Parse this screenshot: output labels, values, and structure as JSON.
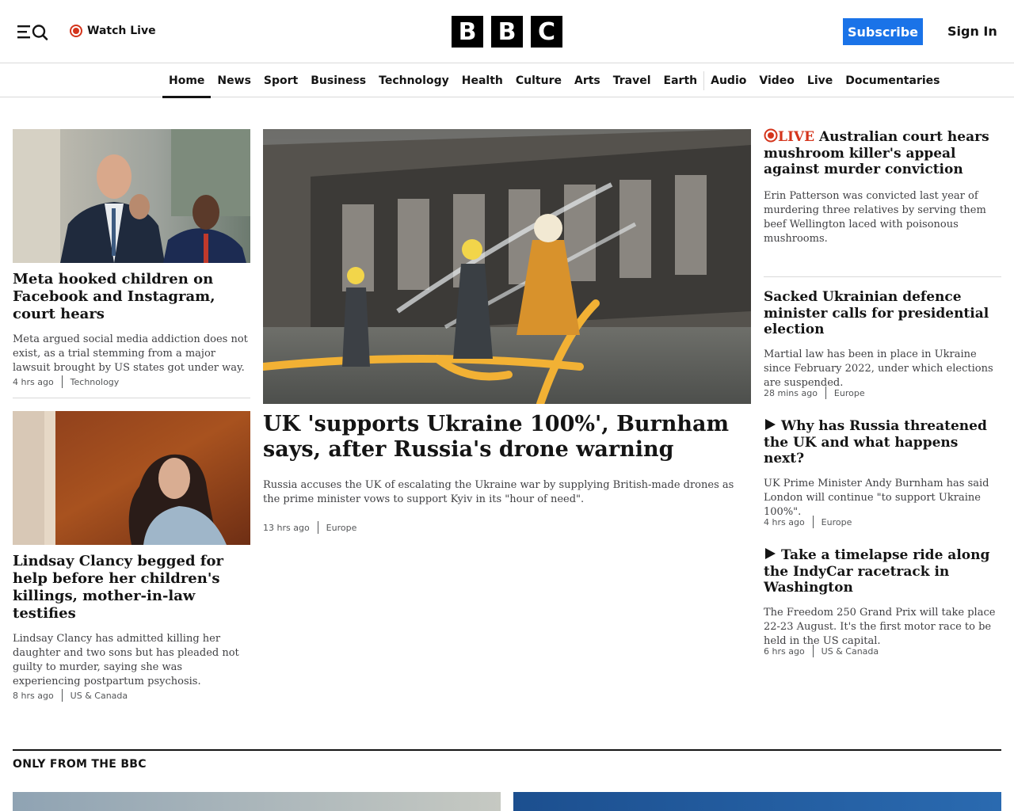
{
  "header": {
    "watch_live": "Watch Live",
    "logo_letters": [
      "B",
      "B",
      "C"
    ],
    "subscribe": "Subscribe",
    "sign_in": "Sign In",
    "accent_color": "#1a73e8",
    "live_color": "#d4351c"
  },
  "nav": {
    "items": [
      {
        "label": "Home",
        "active": true
      },
      {
        "label": "News"
      },
      {
        "label": "Sport"
      },
      {
        "label": "Business"
      },
      {
        "label": "Technology"
      },
      {
        "label": "Health"
      },
      {
        "label": "Culture"
      },
      {
        "label": "Arts"
      },
      {
        "label": "Travel"
      },
      {
        "label": "Earth"
      },
      {
        "label": "Audio"
      },
      {
        "label": "Video"
      },
      {
        "label": "Live"
      },
      {
        "label": "Documentaries"
      }
    ]
  },
  "left_stories": [
    {
      "headline": "Meta hooked children on Facebook and Instagram, court hears",
      "summary": "Meta argued social media addiction does not exist, as a trial stemming from a major lawsuit brought by US states got under way.",
      "time": "4 hrs ago",
      "section": "Technology"
    },
    {
      "headline": "Lindsay Clancy begged for help before her children's killings, mother-in-law testifies",
      "summary": "Lindsay Clancy has admitted killing her daughter and two sons but has pleaded not guilty to murder, saying she was experiencing postpartum psychosis.",
      "time": "8 hrs ago",
      "section": "US & Canada"
    }
  ],
  "main_story": {
    "headline": "UK 'supports Ukraine 100%', Burnham says, after Russia's drone warning",
    "summary": "Russia accuses the UK of escalating the Ukraine war by supplying British-made drones as the prime minister vows to support Kyiv in its \"hour of need\".",
    "time": "13 hrs ago",
    "section": "Europe"
  },
  "right_stories": [
    {
      "live_label": "LIVE",
      "headline": "Australian court hears mushroom killer's appeal against murder conviction",
      "summary": "Erin Patterson was convicted last year of murdering three relatives by serving them beef Wellington laced with poisonous mushrooms."
    },
    {
      "headline": "Sacked Ukrainian defence minister calls for presidential election",
      "summary": "Martial law has been in place in Ukraine since February 2022, under which elections are suspended.",
      "time": "28 mins ago",
      "section": "Europe"
    },
    {
      "icon": "play-icon",
      "headline": "Why has Russia threatened the UK and what happens next?",
      "summary": "UK Prime Minister Andy Burnham has said London will continue \"to support Ukraine 100%\".",
      "time": "4 hrs ago",
      "section": "Europe"
    },
    {
      "icon": "play-icon",
      "headline": "Take a timelapse ride along the IndyCar racetrack in Washington",
      "summary": "The Freedom 250 Grand Prix will take place 22-23 August. It's the first motor race to be held in the US capital.",
      "time": "6 hrs ago",
      "section": "US & Canada"
    }
  ],
  "only_from_bbc": {
    "title": "ONLY FROM THE BBC"
  }
}
